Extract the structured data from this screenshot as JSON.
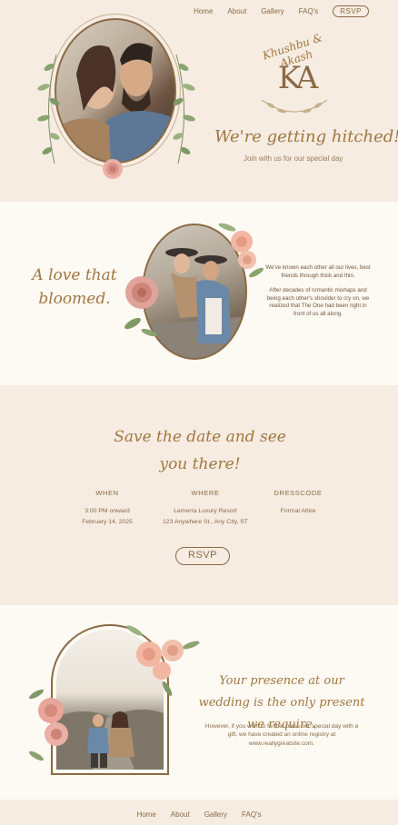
{
  "nav": {
    "home": "Home",
    "about": "About",
    "gallery": "Gallery",
    "faqs": "FAQ's",
    "rsvp": "RSVP"
  },
  "logo": {
    "names": "Khushbu & Akash",
    "monogram": "KA"
  },
  "hero": {
    "headline": "We're getting hitched!",
    "subline": "Join with us for our special day"
  },
  "love": {
    "title": "A love that bloomed.",
    "paragraph1": "We've known each other all our lives, best friends through thick and thin.",
    "paragraph2": "After decades of romantic mishaps and being each other's shoulder to cry on, we realized that The One had been right in front of us all along."
  },
  "save_date": {
    "title": "Save the date and see you there!",
    "when": {
      "heading": "WHEN",
      "line1": "3:00 PM onward",
      "line2": "February 14, 2025"
    },
    "where": {
      "heading": "WHERE",
      "line1": "Lemerra Luxury Resort",
      "line2": "123 Anywhere St., Any City, ST"
    },
    "dresscode": {
      "heading": "DRESSCODE",
      "line1": "Formal Attire"
    },
    "rsvp_button": "RSVP"
  },
  "gift": {
    "title": "Your presence at our wedding is the only present we require.",
    "text": "However, if you wish to further bless our special day with a gift, we have created an online registry at www.reallygreatsite.com."
  },
  "footer": {
    "home": "Home",
    "about": "About",
    "gallery": "Gallery",
    "faqs": "FAQ's"
  },
  "colors": {
    "accent": "#8a6a44",
    "script": "#a0773f",
    "bg_warm": "#f6ece2",
    "bg_light": "#fdf9f3",
    "rose": "#e8a598"
  }
}
